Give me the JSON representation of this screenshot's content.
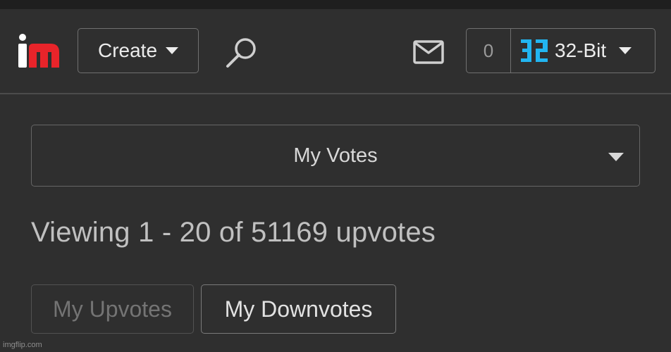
{
  "header": {
    "create_label": "Create",
    "points": "0",
    "username": "32-Bit",
    "colors": {
      "logo_red": "#e8242a",
      "avatar_blue": "#22b5f0"
    }
  },
  "icons": [
    "logo",
    "chevron-down-icon",
    "search-icon",
    "mail-icon",
    "avatar-icon"
  ],
  "votes_select": {
    "selected": "My Votes"
  },
  "summary": {
    "text": "Viewing 1 - 20 of 51169 upvotes"
  },
  "tabs": {
    "upvotes": "My Upvotes",
    "downvotes": "My Downvotes"
  },
  "watermark": "imgflip.com"
}
